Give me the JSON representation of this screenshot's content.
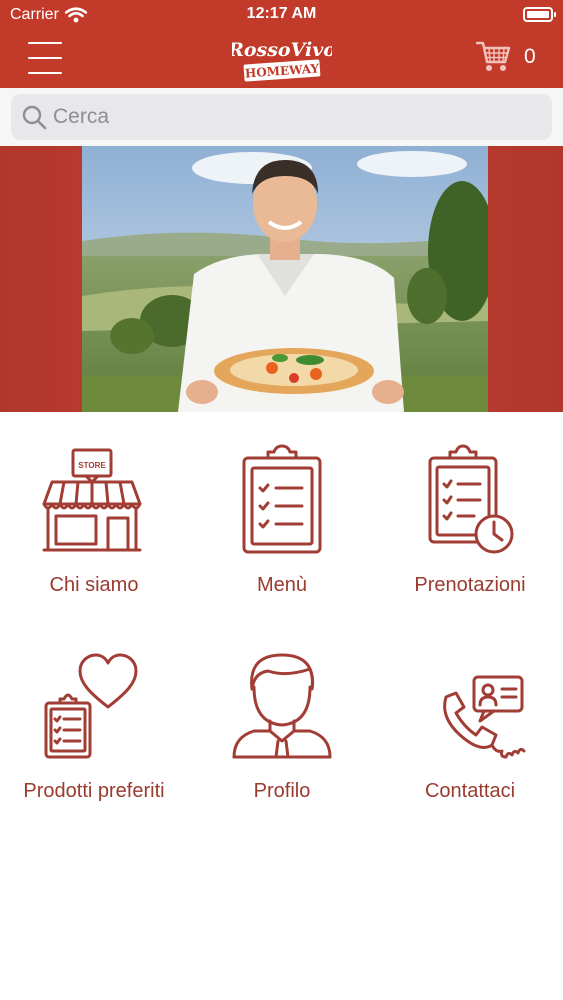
{
  "status_bar": {
    "carrier": "Carrier",
    "time": "12:17 AM"
  },
  "nav": {
    "cart_count": "0",
    "logo_line1": "RossoVivo",
    "logo_line2": "HOMEWAY"
  },
  "search": {
    "placeholder": "Cerca",
    "value": ""
  },
  "colors": {
    "brand": "#c23a2a",
    "icon": "#a13d35",
    "label": "#9b3a2e"
  },
  "menu": [
    {
      "label": "Chi siamo",
      "icon": "store-icon"
    },
    {
      "label": "Menù",
      "icon": "clipboard-list-icon"
    },
    {
      "label": "Prenotazioni",
      "icon": "clipboard-clock-icon"
    },
    {
      "label": "Prodotti preferiti",
      "icon": "heart-clipboard-icon"
    },
    {
      "label": "Profilo",
      "icon": "user-icon"
    },
    {
      "label": "Contattaci",
      "icon": "phone-contact-icon"
    }
  ],
  "store_sign": "STORE"
}
